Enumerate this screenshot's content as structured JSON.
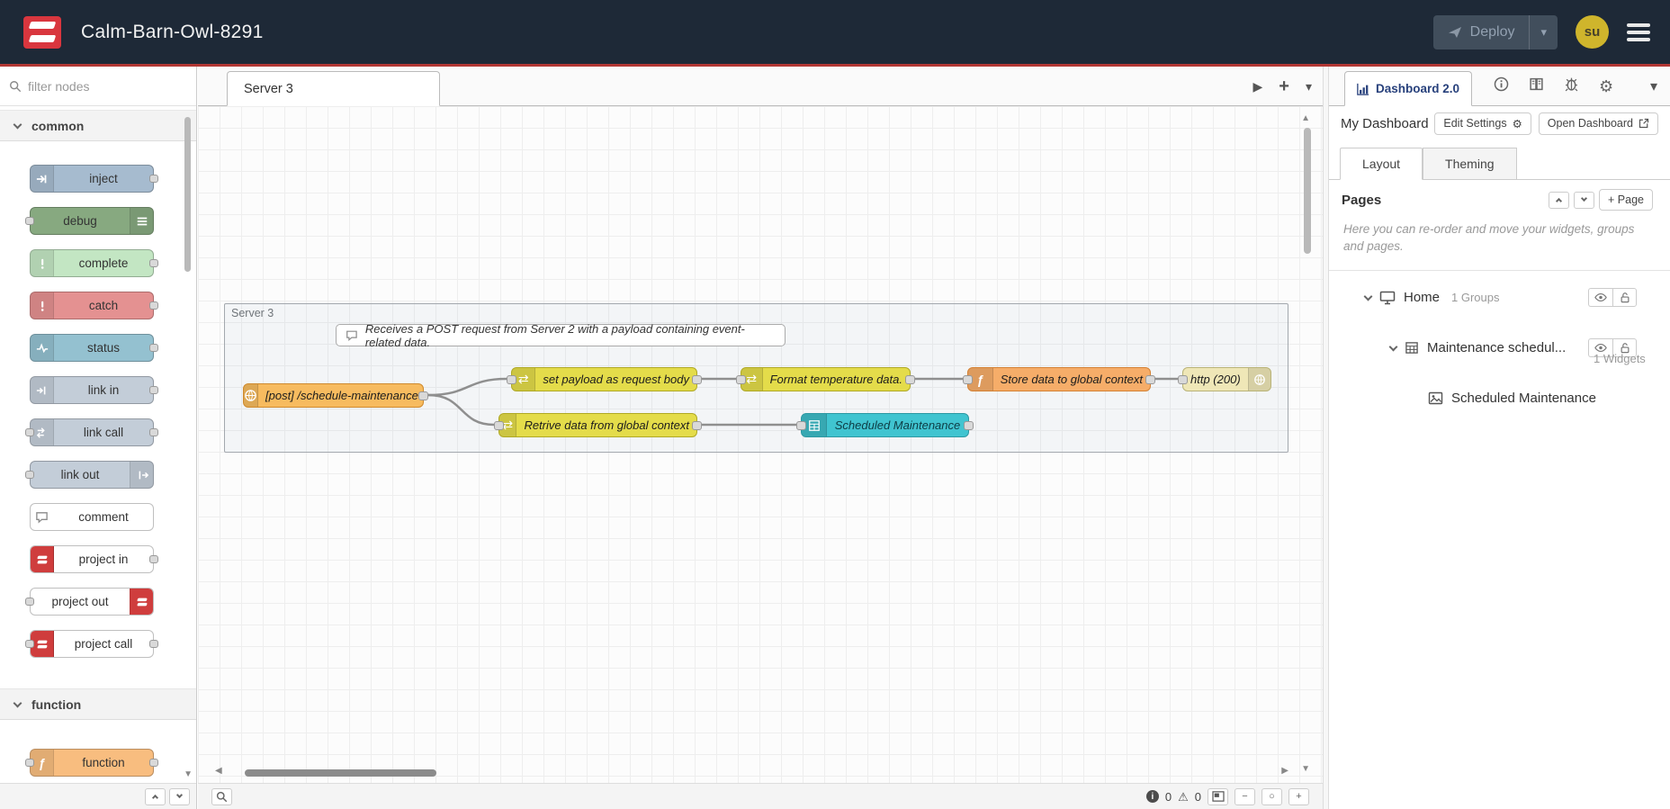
{
  "header": {
    "title": "Calm-Barn-Owl-8291",
    "deploy": {
      "label": "Deploy"
    },
    "user": {
      "initials": "su"
    }
  },
  "icons": {
    "caret_down": "▾",
    "play": "▶",
    "plus": "+",
    "scroll_up": "▲",
    "scroll_down": "▼",
    "scroll_left": "◀",
    "scroll_right": "▶",
    "zoom_out": "−",
    "zoom_reset": "○",
    "zoom_in": "+",
    "gear": "⚙",
    "warning": "⚠",
    "info_letter": "i",
    "function_glyph": "ƒ",
    "swap_arrows": "⇄"
  },
  "palette": {
    "search_placeholder": "filter nodes",
    "categories": [
      {
        "label": "common",
        "items": [
          {
            "label": "inject"
          },
          {
            "label": "debug"
          },
          {
            "label": "complete"
          },
          {
            "label": "catch"
          },
          {
            "label": "status"
          },
          {
            "label": "link in"
          },
          {
            "label": "link call"
          },
          {
            "label": "link out"
          },
          {
            "label": "comment"
          },
          {
            "label": "project in"
          },
          {
            "label": "project out"
          },
          {
            "label": "project call"
          }
        ]
      },
      {
        "label": "function",
        "items": [
          {
            "label": "function"
          }
        ]
      }
    ]
  },
  "workspace": {
    "tabs": [
      {
        "label": "Server 3"
      }
    ],
    "group_label": "Server 3",
    "comment": "Receives a POST request from Server 2 with a payload containing event-related data.",
    "nodes": [
      {
        "id": "http-in",
        "label": "[post] /schedule-maintenance"
      },
      {
        "id": "change-set-payload",
        "label": "set payload as request body"
      },
      {
        "id": "change-format-temperature",
        "label": "Format temperature data."
      },
      {
        "id": "function-store-global",
        "label": "Store data to global context"
      },
      {
        "id": "http-response",
        "label": "http (200)"
      },
      {
        "id": "change-retrieve-global",
        "label": "Retrive data from global context"
      },
      {
        "id": "ui-table",
        "label": "Scheduled Maintenance"
      }
    ],
    "status_bar": {
      "info_count": "0",
      "warning_count": "0"
    }
  },
  "sidebar": {
    "active_tab": "Dashboard 2.0",
    "dashboard_name": "My Dashboard",
    "edit_settings_label": "Edit Settings",
    "open_dashboard_label": "Open Dashboard",
    "tabs": [
      {
        "label": "Layout"
      },
      {
        "label": "Theming"
      }
    ],
    "pages_title": "Pages",
    "add_page_label": "+ Page",
    "help_text": "Here you can re-order and move your widgets, groups and pages.",
    "tree": {
      "page": {
        "label": "Home",
        "meta": "1 Groups"
      },
      "group": {
        "label": "Maintenance schedul...",
        "meta": "1 Widgets"
      },
      "widget": {
        "label": "Scheduled Maintenance"
      }
    }
  },
  "colors": {
    "header_bg": "#1e2937",
    "accent_red": "#b23734",
    "node_http_in": "#f7bb5f",
    "node_change": "#e4dc4a",
    "node_function": "#f6ad69",
    "node_http_response": "#efe7b7",
    "node_ui_table": "#40c4d0",
    "sidebar_tab_text": "#28417c",
    "avatar_bg": "#cfb52c"
  }
}
